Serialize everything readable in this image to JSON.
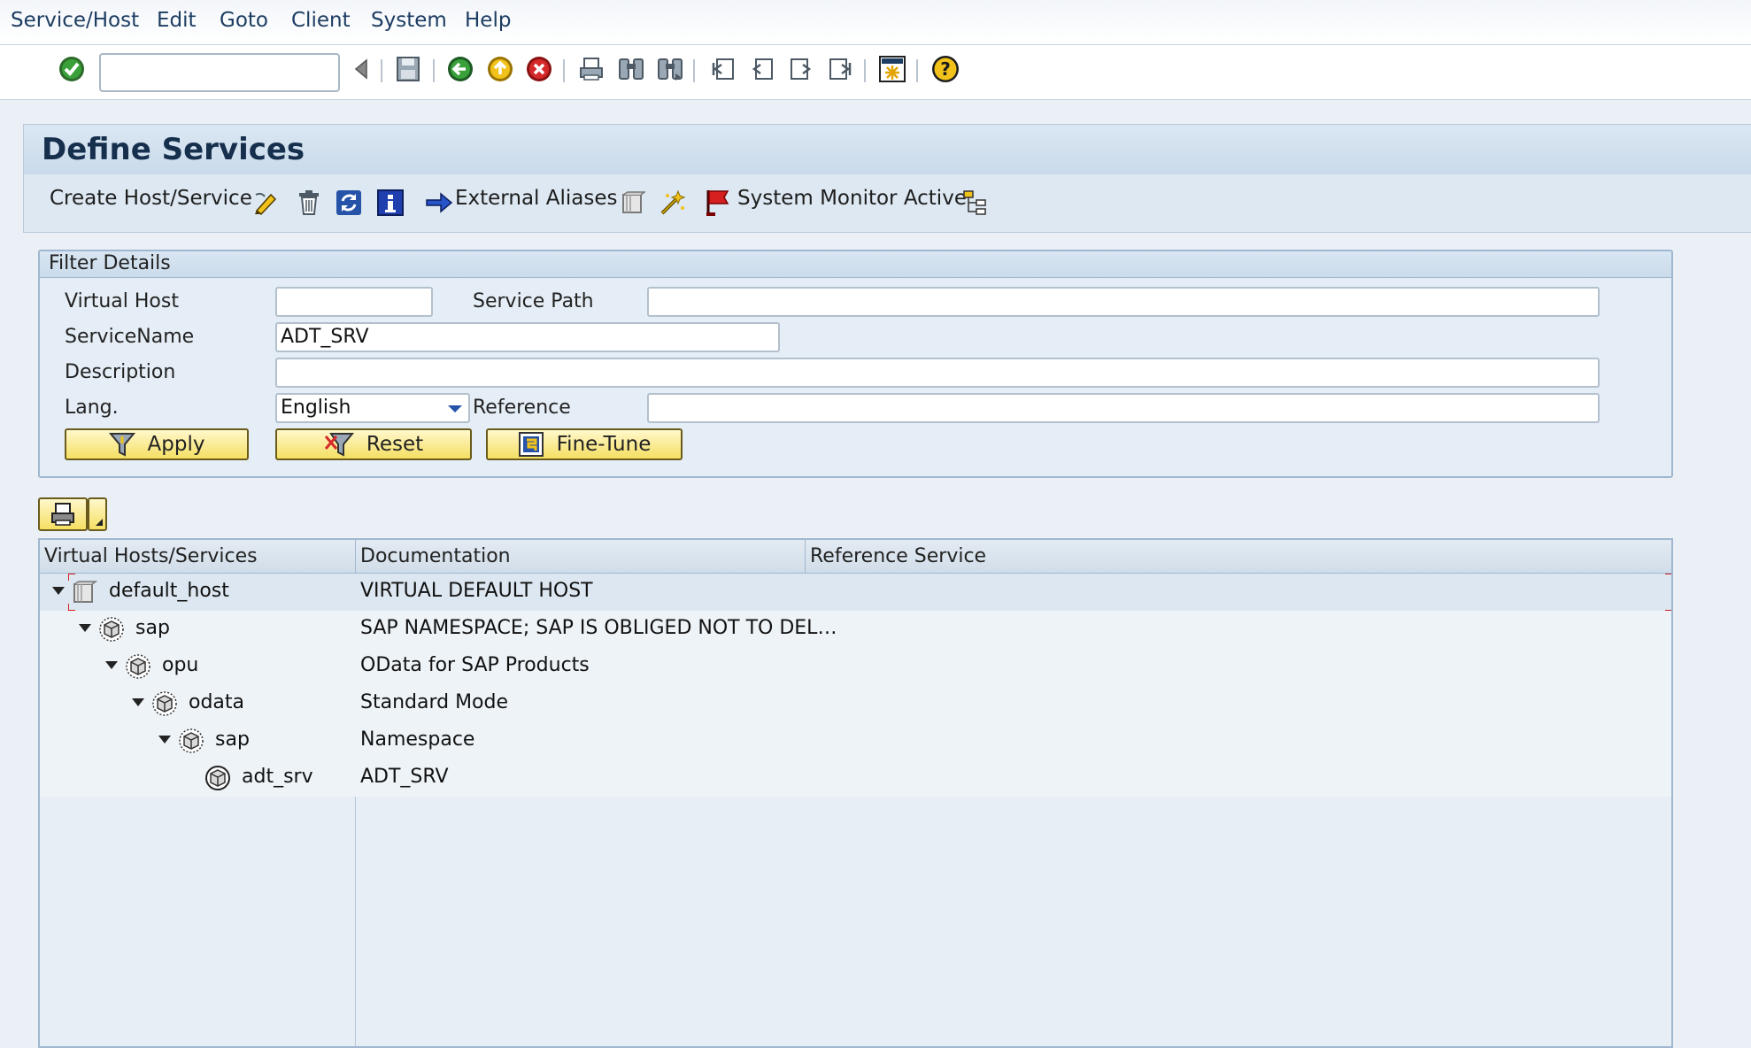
{
  "menubar": {
    "items": [
      "Service/Host",
      "Edit",
      "Goto",
      "Client",
      "System",
      "Help"
    ]
  },
  "toolbar": {
    "command_field_value": "",
    "icons": [
      "enter-check-icon",
      "command-field",
      "back-triangle-icon",
      "save-icon",
      "back-icon",
      "exit-icon",
      "cancel-icon",
      "print-icon",
      "find-icon",
      "find-next-icon",
      "first-page-icon",
      "previous-page-icon",
      "next-page-icon",
      "last-page-icon",
      "new-session-icon",
      "help-icon"
    ]
  },
  "title": "Define Services",
  "app_toolbar": {
    "create_label": "Create Host/Service",
    "external_aliases_label": "External Aliases",
    "system_monitor_label": "System Monitor Active",
    "icons": [
      "change-icon",
      "delete-icon",
      "refresh-icon",
      "information-icon",
      "arrow-right-icon",
      "host-icon",
      "activate-wand-icon",
      "flag-icon",
      "hierarchy-icon"
    ]
  },
  "filter": {
    "header": "Filter Details",
    "virtual_host_label": "Virtual Host",
    "virtual_host_value": "",
    "service_path_label": "Service Path",
    "service_path_value": "",
    "service_name_label": "ServiceName",
    "service_name_value": "ADT_SRV",
    "description_label": "Description",
    "description_value": "",
    "lang_label": "Lang.",
    "lang_value": "English",
    "reference_label": "Reference",
    "reference_value": "",
    "apply_label": "Apply",
    "reset_label": "Reset",
    "finetune_label": "Fine-Tune"
  },
  "tree": {
    "columns": [
      "Virtual Hosts/Services",
      "Documentation",
      "Reference Service"
    ],
    "rows": [
      {
        "name": "default_host",
        "doc": "VIRTUAL DEFAULT HOST",
        "level": 0,
        "expanded": true,
        "type": "host"
      },
      {
        "name": "sap",
        "doc": "SAP NAMESPACE; SAP IS OBLIGED NOT TO DEL…",
        "level": 1,
        "expanded": true,
        "type": "service"
      },
      {
        "name": "opu",
        "doc": "OData for SAP Products",
        "level": 2,
        "expanded": true,
        "type": "service"
      },
      {
        "name": "odata",
        "doc": "Standard Mode",
        "level": 3,
        "expanded": true,
        "type": "service"
      },
      {
        "name": "sap",
        "doc": "Namespace",
        "level": 4,
        "expanded": true,
        "type": "service"
      },
      {
        "name": "adt_srv",
        "doc": "ADT_SRV",
        "level": 5,
        "expanded": false,
        "type": "service-active"
      }
    ]
  },
  "colors": {
    "accent": "#f5df62",
    "title_bg": "#c9daea",
    "panel_bg": "#e5eef6",
    "selection_marker": "#d42020"
  }
}
